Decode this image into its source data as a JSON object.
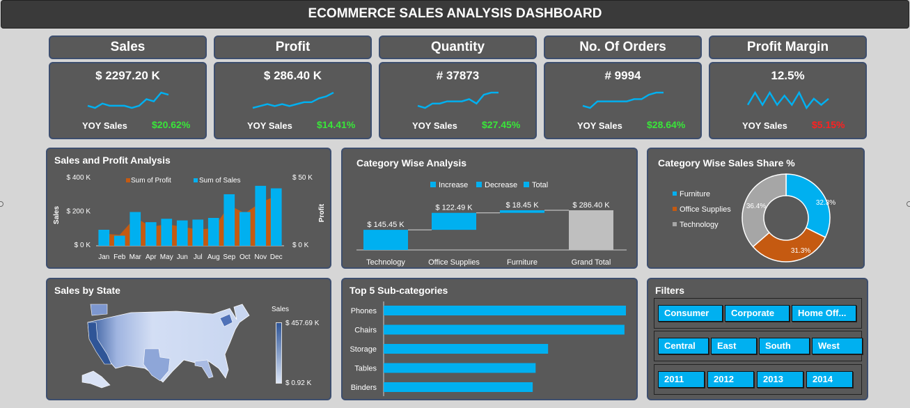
{
  "title": "ECOMMERCE SALES ANALYSIS DASHBOARD",
  "kpis": [
    {
      "label": "Sales",
      "value": "$ 2297.20 K",
      "yoy_label": "YOY Sales",
      "yoy": "$20.62%",
      "yoy_color": "#39e639",
      "spark": [
        4,
        3,
        5,
        4,
        4,
        4,
        3,
        4,
        7,
        6,
        10,
        9
      ]
    },
    {
      "label": "Profit",
      "value": "$ 286.40 K",
      "yoy_label": "YOY Sales",
      "yoy": "$14.41%",
      "yoy_color": "#39e639",
      "spark": [
        3,
        4,
        5,
        4,
        5,
        4,
        5,
        6,
        6,
        8,
        9,
        11
      ]
    },
    {
      "label": "Quantity",
      "value": "# 37873",
      "yoy_label": "YOY Sales",
      "yoy": "$27.45%",
      "yoy_color": "#39e639",
      "spark": [
        3,
        2,
        4,
        4,
        5,
        5,
        5,
        6,
        4,
        8,
        9,
        9
      ]
    },
    {
      "label": "No. Of Orders",
      "value": "# 9994",
      "yoy_label": "YOY Sales",
      "yoy": "$28.64%",
      "yoy_color": "#39e639",
      "spark": [
        4,
        3,
        6,
        6,
        6,
        6,
        6,
        7,
        7,
        9,
        10,
        10
      ]
    },
    {
      "label": "Profit Margin",
      "value": "12.5%",
      "yoy_label": "YOY Sales",
      "yoy": "$5.15%",
      "yoy_color": "#ff2020",
      "spark": [
        5,
        9,
        5,
        9,
        5,
        8,
        5,
        9,
        4,
        7,
        5,
        7
      ]
    }
  ],
  "sales_profit": {
    "title": "Sales and Profit Analysis",
    "chart_data": {
      "type": "bar",
      "categories": [
        "Jan",
        "Feb",
        "Mar",
        "Apr",
        "May",
        "Jun",
        "Jul",
        "Aug",
        "Sep",
        "Oct",
        "Nov",
        "Dec"
      ],
      "series": [
        {
          "name": "Sum of Sales",
          "axis": "left",
          "values": [
            95,
            60,
            200,
            140,
            160,
            150,
            155,
            165,
            305,
            200,
            355,
            340
          ],
          "color": "#00b0f0"
        },
        {
          "name": "Sum of Profit",
          "axis": "right",
          "values": [
            9,
            8,
            21,
            14,
            16,
            14,
            12,
            13,
            30,
            24,
            32,
            37
          ],
          "color": "#c55a11"
        }
      ],
      "ylabel": "Sales",
      "y2label": "Profit",
      "yticks": [
        "$ 400 K",
        "$ 200 K",
        "$ 0 K"
      ],
      "y2ticks": [
        "$ 50 K",
        "$ 0 K"
      ],
      "ylim": [
        0,
        400
      ],
      "y2lim": [
        0,
        50
      ]
    }
  },
  "category": {
    "title": "Category Wise Analysis",
    "legend": [
      "Increase",
      "Decrease",
      "Total"
    ],
    "chart_data": {
      "type": "bar",
      "subtype": "waterfall",
      "categories": [
        "Technology",
        "Office Supplies",
        "Furniture",
        "Grand Total"
      ],
      "values": [
        145.45,
        122.49,
        18.45,
        286.4
      ],
      "labels": [
        "$ 145.45 K",
        "$ 122.49 K",
        "$ 18.45 K",
        "$ 286.40 K"
      ],
      "kinds": [
        "increase",
        "increase",
        "increase",
        "total"
      ],
      "colors": {
        "increase": "#00b0f0",
        "decrease": "#00b0f0",
        "total": "#bfbfbf"
      }
    }
  },
  "share": {
    "title": "Category Wise Sales Share %",
    "chart_data": {
      "type": "pie",
      "subtype": "donut",
      "labels": [
        "Furniture",
        "Office Supplies",
        "Technology"
      ],
      "values": [
        32.3,
        31.3,
        36.4
      ],
      "display": [
        "32.3%",
        "31.3%",
        "36.4%"
      ],
      "colors": [
        "#00b0f0",
        "#c55a11",
        "#a6a6a6"
      ]
    }
  },
  "state": {
    "title": "Sales by State",
    "legend_title": "Sales",
    "legend_max": "$ 457.69 K",
    "legend_min": "$ 0.92 K",
    "color_low": "#dce6f7",
    "color_high": "#2f5597"
  },
  "subcat": {
    "title": "Top 5 Sub-categories",
    "chart_data": {
      "type": "bar",
      "orientation": "horizontal",
      "categories": [
        "Phones",
        "Chairs",
        "Storage",
        "Tables",
        "Binders"
      ],
      "values": [
        330,
        328,
        224,
        207,
        203
      ],
      "color": "#00b0f0"
    }
  },
  "filters": {
    "title": "Filters",
    "segments": [
      "Consumer",
      "Corporate",
      "Home Off..."
    ],
    "regions": [
      "Central",
      "East",
      "South",
      "West"
    ],
    "years": [
      "2011",
      "2012",
      "2013",
      "2014"
    ]
  }
}
